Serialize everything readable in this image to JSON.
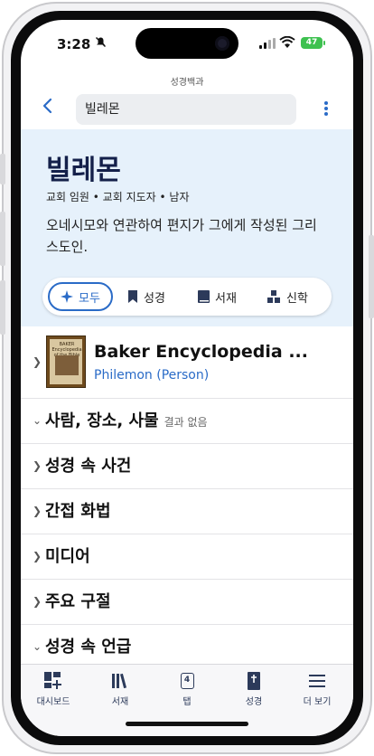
{
  "status": {
    "time": "3:28",
    "battery": "47"
  },
  "app": {
    "name": "성경백과"
  },
  "search": {
    "value": "빌레몬"
  },
  "header": {
    "title": "빌레몬",
    "subtitle": "교회 임원 • 교회 지도자 • 남자",
    "description": "오네시모와 연관하여 편지가 그에게 작성된 그리스도인."
  },
  "filters": {
    "all": "모두",
    "bible": "성경",
    "library": "서재",
    "theology": "신학"
  },
  "book": {
    "title": "Baker Encyclopedia ...",
    "subtitle": "Philemon (Person)",
    "cover_text": "BAKER Encyclopedia of the Bible"
  },
  "sections": [
    {
      "label": "사람, 장소, 사물",
      "note": "결과 없음",
      "expanded": true
    },
    {
      "label": "성경 속 사건",
      "note": "",
      "expanded": false
    },
    {
      "label": "간접 화법",
      "note": "",
      "expanded": false
    },
    {
      "label": "미디어",
      "note": "",
      "expanded": false
    },
    {
      "label": "주요 구절",
      "note": "",
      "expanded": false
    },
    {
      "label": "성경 속 언급",
      "note": "",
      "expanded": true
    }
  ],
  "tabs": {
    "dashboard": "대시보드",
    "library": "서재",
    "tabs": "탭",
    "tabs_count": "4",
    "bible": "성경",
    "more": "더 보기"
  },
  "colors": {
    "accent": "#2a6bc7",
    "band": "#e6f1fb",
    "title": "#14204a"
  }
}
